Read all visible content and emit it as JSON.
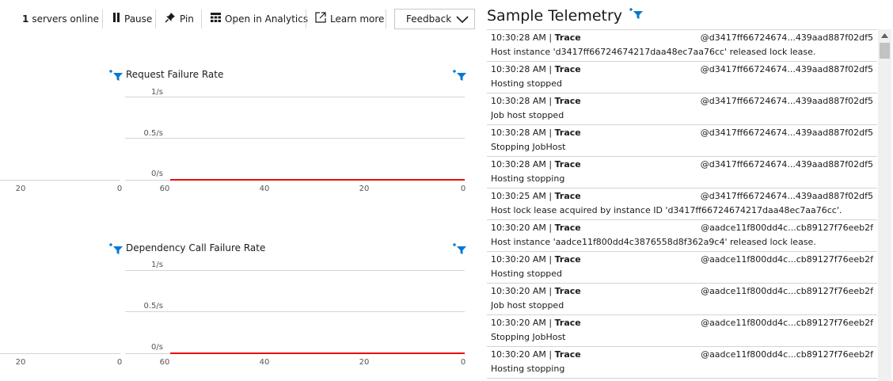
{
  "toolbar": {
    "servers_count": "1",
    "servers_label": "servers online",
    "pause_label": "Pause",
    "pin_label": "Pin",
    "analytics_label": "Open in Analytics",
    "learn_label": "Learn more",
    "feedback_label": "Feedback"
  },
  "charts": [
    {
      "title": "Request Failure Rate",
      "yticks": [
        "1/s",
        "0.5/s",
        "0/s"
      ],
      "xticks": [
        "60",
        "40",
        "20",
        "0"
      ],
      "left_xticks": [
        "20",
        "0"
      ],
      "line_color": "#e8100b",
      "chart_data": {
        "type": "line",
        "x": [
          60,
          0
        ],
        "values": [
          0,
          0
        ]
      }
    },
    {
      "title": "Dependency Call Failure Rate",
      "yticks": [
        "1/s",
        "0.5/s",
        "0/s"
      ],
      "xticks": [
        "60",
        "40",
        "20",
        "0"
      ],
      "left_xticks": [
        "20",
        "0"
      ],
      "line_color": "#e8100b",
      "chart_data": {
        "type": "line",
        "x": [
          60,
          0
        ],
        "values": [
          0,
          0
        ]
      }
    }
  ],
  "telemetry": {
    "title": "Sample Telemetry",
    "rows": [
      {
        "time": "10:30:28 AM",
        "kind": "Trace",
        "host": "@d3417ff66724674...439aad887f02df5",
        "message": "Host instance 'd3417ff66724674217daa48ec7aa76cc' released lock lease."
      },
      {
        "time": "10:30:28 AM",
        "kind": "Trace",
        "host": "@d3417ff66724674...439aad887f02df5",
        "message": "Hosting stopped"
      },
      {
        "time": "10:30:28 AM",
        "kind": "Trace",
        "host": "@d3417ff66724674...439aad887f02df5",
        "message": "Job host stopped"
      },
      {
        "time": "10:30:28 AM",
        "kind": "Trace",
        "host": "@d3417ff66724674...439aad887f02df5",
        "message": "Stopping JobHost"
      },
      {
        "time": "10:30:28 AM",
        "kind": "Trace",
        "host": "@d3417ff66724674...439aad887f02df5",
        "message": "Hosting stopping"
      },
      {
        "time": "10:30:25 AM",
        "kind": "Trace",
        "host": "@d3417ff66724674...439aad887f02df5",
        "message": "Host lock lease acquired by instance ID 'd3417ff66724674217daa48ec7aa76cc'."
      },
      {
        "time": "10:30:20 AM",
        "kind": "Trace",
        "host": "@aadce11f800dd4c...cb89127f76eeb2f",
        "message": "Host instance 'aadce11f800dd4c3876558d8f362a9c4' released lock lease."
      },
      {
        "time": "10:30:20 AM",
        "kind": "Trace",
        "host": "@aadce11f800dd4c...cb89127f76eeb2f",
        "message": "Hosting stopped"
      },
      {
        "time": "10:30:20 AM",
        "kind": "Trace",
        "host": "@aadce11f800dd4c...cb89127f76eeb2f",
        "message": "Job host stopped"
      },
      {
        "time": "10:30:20 AM",
        "kind": "Trace",
        "host": "@aadce11f800dd4c...cb89127f76eeb2f",
        "message": "Stopping JobHost"
      },
      {
        "time": "10:30:20 AM",
        "kind": "Trace",
        "host": "@aadce11f800dd4c...cb89127f76eeb2f",
        "message": "Hosting stopping"
      }
    ]
  },
  "icons": {
    "pause": "pause-icon",
    "pin": "pin-icon",
    "analytics": "grid-icon",
    "learn": "external-link-icon",
    "filter": "filter-add-icon",
    "accent_color": "#0078d4"
  }
}
